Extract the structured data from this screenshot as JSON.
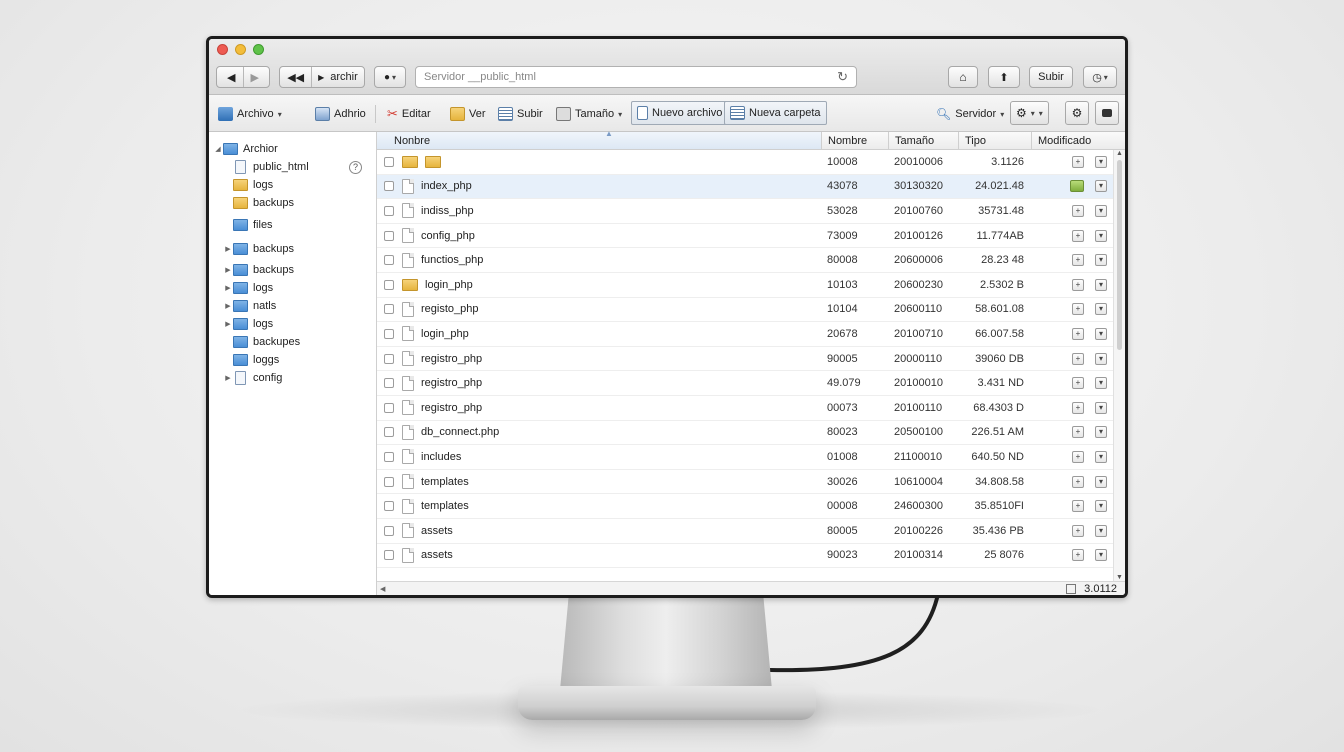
{
  "window": {
    "address_placeholder": "Servidor __public_html",
    "nav_label": "archir",
    "upload_label": "Subir"
  },
  "toolbar": {
    "archivo": "Archivo",
    "adhrio": "Adhrio",
    "editar": "Editar",
    "ver": "Ver",
    "subir": "Subir",
    "tamano": "Tamaño",
    "nuevo_archivo": "Nuevo archivo",
    "nueva_carpeta": "Nueva carpeta",
    "servidor": "Servidor"
  },
  "sidebar": {
    "root": "Archior",
    "items": [
      {
        "label": "public_html",
        "icon": "doc"
      },
      {
        "label": "logs",
        "icon": "yellow"
      },
      {
        "label": "backups",
        "icon": "yellow"
      },
      {
        "label": "files",
        "icon": "blue"
      },
      {
        "label": "backups",
        "icon": "blue"
      },
      {
        "label": "backups",
        "icon": "blue"
      },
      {
        "label": "logs",
        "icon": "blue"
      },
      {
        "label": "natls",
        "icon": "blue"
      },
      {
        "label": "logs",
        "icon": "blue"
      },
      {
        "label": "backupes",
        "icon": "blue"
      },
      {
        "label": "loggs",
        "icon": "blue"
      },
      {
        "label": "config",
        "icon": "doc"
      }
    ]
  },
  "columns": {
    "nombre_main": "Nonbre",
    "nombre": "Nombre",
    "tamano": "Tamaño",
    "tipo": "Tipo",
    "modificado": "Modificado"
  },
  "files": [
    {
      "name": "",
      "type": "folder",
      "n": "10008",
      "t": "20010006",
      "tipo": "3.1126",
      "mod": "plus"
    },
    {
      "name": "index_php",
      "type": "file",
      "n": "43078",
      "t": "30130320",
      "tipo": "24.021.48",
      "mod": "star"
    },
    {
      "name": "indiss_php",
      "type": "file",
      "n": "53028",
      "t": "20100760",
      "tipo": "35731.48",
      "mod": "plus"
    },
    {
      "name": "config_php",
      "type": "file",
      "n": "73009",
      "t": "20100126",
      "tipo": "11.774AB",
      "mod": "plus"
    },
    {
      "name": "functios_php",
      "type": "file",
      "n": "80008",
      "t": "20600006",
      "tipo": "28.23 48",
      "mod": "plus"
    },
    {
      "name": "login_php",
      "type": "folder",
      "n": "10103",
      "t": "20600230",
      "tipo": "2.5302 B",
      "mod": "plus"
    },
    {
      "name": "registo_php",
      "type": "file",
      "n": "10104",
      "t": "20600110",
      "tipo": "58.601.08",
      "mod": "plus"
    },
    {
      "name": "login_php",
      "type": "file",
      "n": "20678",
      "t": "20100710",
      "tipo": "66.007.58",
      "mod": "plus"
    },
    {
      "name": "registro_php",
      "type": "file",
      "n": "90005",
      "t": "20000110",
      "tipo": "39060 DB",
      "mod": "plus"
    },
    {
      "name": "registro_php",
      "type": "file",
      "n": "49.079",
      "t": "20100010",
      "tipo": "3.431 ND",
      "mod": "plus"
    },
    {
      "name": "registro_php",
      "type": "file",
      "n": "00073",
      "t": "20100110",
      "tipo": "68.4303 D",
      "mod": "plus"
    },
    {
      "name": "db_connect.php",
      "type": "file",
      "n": "80023",
      "t": "20500100",
      "tipo": "226.51 AM",
      "mod": "plus"
    },
    {
      "name": "includes",
      "type": "file",
      "n": "01008",
      "t": "21100010",
      "tipo": "640.50 ND",
      "mod": "plus"
    },
    {
      "name": "templates",
      "type": "file",
      "n": "30026",
      "t": "10610004",
      "tipo": "34.808.58",
      "mod": "plus"
    },
    {
      "name": "templates",
      "type": "file",
      "n": "00008",
      "t": "24600300",
      "tipo": "35.8510FI",
      "mod": "plus"
    },
    {
      "name": "assets",
      "type": "file",
      "n": "80005",
      "t": "20100226",
      "tipo": "35.436 PB",
      "mod": "plus"
    },
    {
      "name": "assets",
      "type": "file",
      "n": "90023",
      "t": "20100314",
      "tipo": "25 8076",
      "mod": "plus"
    }
  ],
  "status": {
    "value": "3.0112"
  }
}
